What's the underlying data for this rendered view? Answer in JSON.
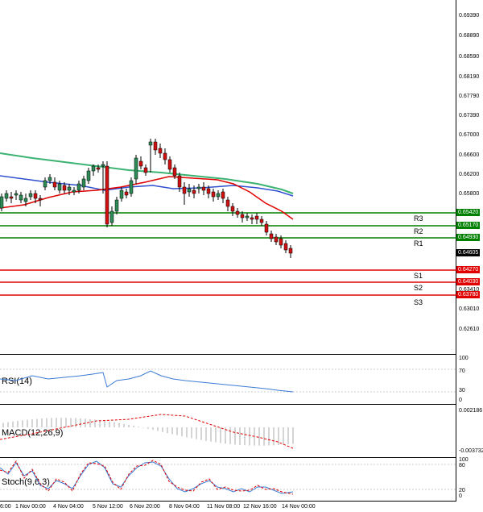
{
  "price_axis": [
    "0.69390",
    "0.68890",
    "0.68590",
    "0.68190",
    "0.67790",
    "0.67390",
    "0.67000",
    "0.66600",
    "0.66200",
    "0.65800",
    "0.64605",
    "0.63410",
    "0.63010",
    "0.62610"
  ],
  "levels": {
    "R3": {
      "label": "R3",
      "value": "0.65420"
    },
    "R2": {
      "label": "R2",
      "value": "0.65170"
    },
    "R1": {
      "label": "R1",
      "value": "0.64930"
    },
    "current": {
      "value": "0.64605"
    },
    "S1": {
      "label": "S1",
      "value": "0.64270"
    },
    "S2": {
      "label": "S2",
      "value": "0.64030"
    },
    "S3": {
      "label": "S3",
      "value": "0.63780"
    }
  },
  "rsi": {
    "label": "RSI(14)",
    "ticks": [
      "100",
      "70",
      "30",
      "0"
    ]
  },
  "macd": {
    "label": "MACD(12,26,9)",
    "ticks": [
      "0.002186",
      "-0.003732"
    ]
  },
  "stoch": {
    "label": "Stoch(9,6,3)",
    "ticks": [
      "100",
      "80",
      "20",
      "0"
    ]
  },
  "time_axis": [
    "6:00",
    "1 Nov 00:00",
    "4 Nov 04:00",
    "5 Nov 12:00",
    "6 Nov 20:00",
    "8 Nov 04:00",
    "11 Nov 08:00",
    "12 Nov 16:00",
    "14 Nov 00:00"
  ],
  "colors": {
    "support": "#e00000",
    "resistance": "#008000",
    "ma_green": "#3cb371",
    "ma_blue": "#3050d0",
    "ma_red": "#e00000",
    "bull": "#2e8b57",
    "bear": "#d01010",
    "indicator": "#3a7bd5",
    "signal": "#e00000"
  }
}
